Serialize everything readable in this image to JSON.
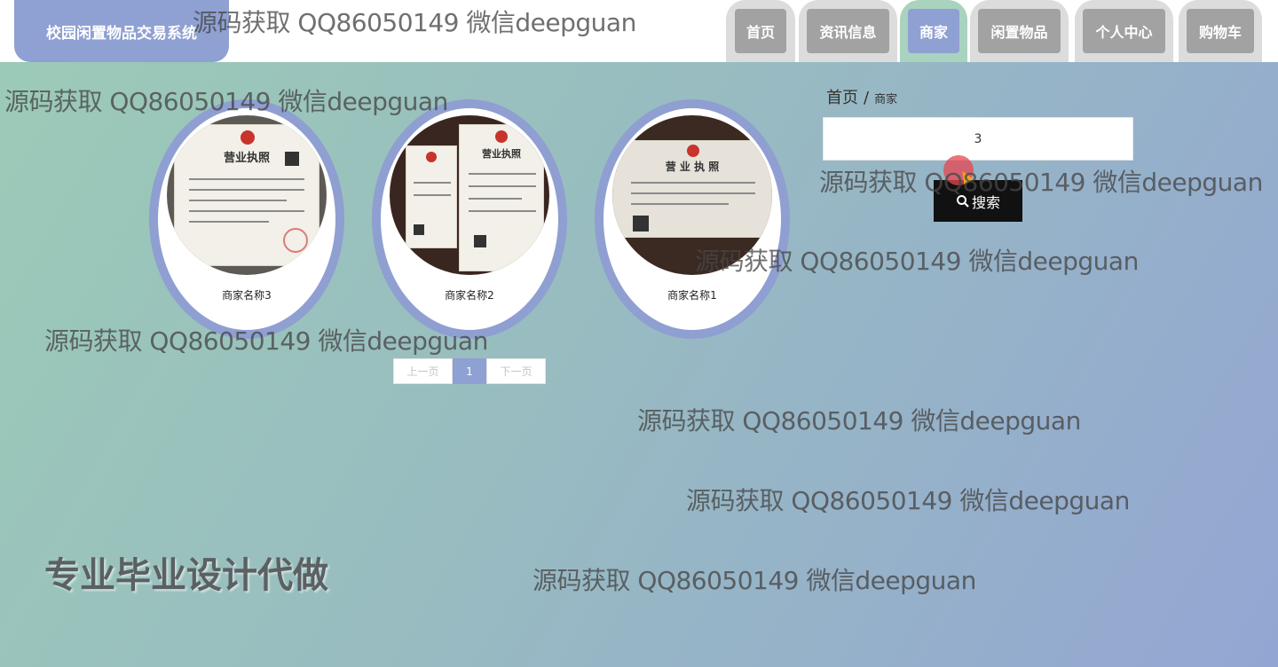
{
  "header": {
    "logo_text": "校园闲置物品交易系统",
    "nav": [
      {
        "label": "首页"
      },
      {
        "label": "资讯信息"
      },
      {
        "label": "商家"
      },
      {
        "label": "闲置物品"
      },
      {
        "label": "个人中心"
      },
      {
        "label": "购物车"
      }
    ],
    "active_nav": "商家"
  },
  "breadcrumb": {
    "home": "首页",
    "separator": "/",
    "current": "商家"
  },
  "search": {
    "value": "3",
    "button_label": "搜索",
    "button_icon": "search-icon"
  },
  "merchants": [
    {
      "name": "商家名称3",
      "image": "business-license-photo"
    },
    {
      "name": "商家名称2",
      "image": "business-license-photo"
    },
    {
      "name": "商家名称1",
      "image": "business-license-photo"
    }
  ],
  "license_text": {
    "a": "营业执照",
    "b": "营业执照",
    "c": "营 业 执 照"
  },
  "pagination": {
    "prev": "上一页",
    "current": "1",
    "next": "下一页"
  },
  "watermark_text": "源码获取 QQ86050149 微信deepguan",
  "slogan": "专业毕业设计代做",
  "colors": {
    "accent": "#8fa0d2",
    "nav_inactive": "#a2a2a2",
    "active_tab_bg": "#a9d3bf",
    "search_button": "#111111"
  }
}
